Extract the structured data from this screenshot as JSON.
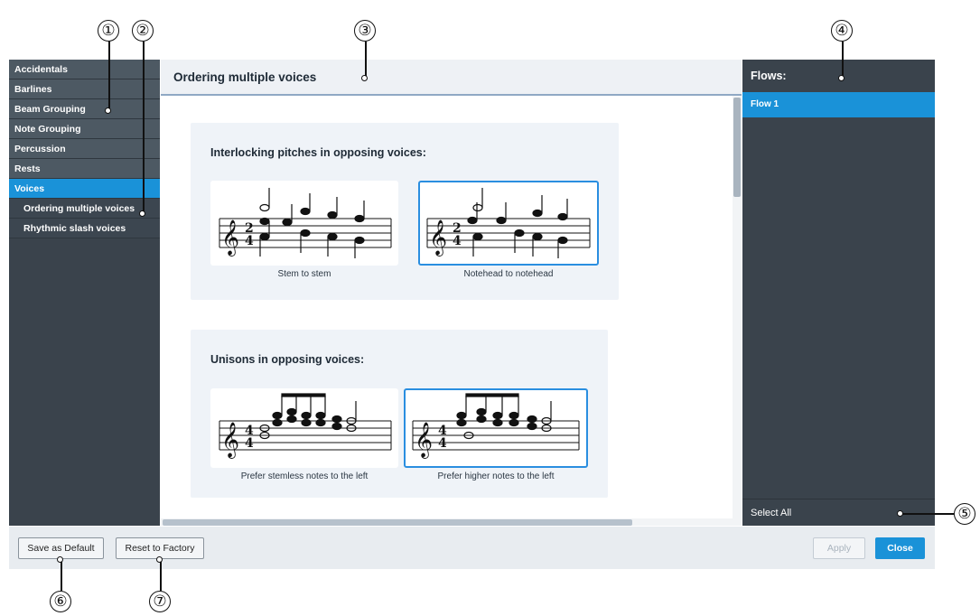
{
  "sidebar": {
    "items": [
      {
        "label": "Accidentals",
        "type": "category"
      },
      {
        "label": "Barlines",
        "type": "category"
      },
      {
        "label": "Beam Grouping",
        "type": "category"
      },
      {
        "label": "Note Grouping",
        "type": "category"
      },
      {
        "label": "Percussion",
        "type": "category"
      },
      {
        "label": "Rests",
        "type": "category"
      },
      {
        "label": "Voices",
        "type": "category",
        "active": true
      },
      {
        "label": "Ordering multiple voices",
        "type": "subcategory"
      },
      {
        "label": "Rhythmic slash voices",
        "type": "subcategory"
      }
    ]
  },
  "main": {
    "title": "Ordering multiple voices",
    "sections": [
      {
        "heading": "Interlocking pitches in opposing voices:",
        "options": [
          {
            "label": "Stem to stem",
            "selected": false
          },
          {
            "label": "Notehead to notehead",
            "selected": true
          }
        ]
      },
      {
        "heading": "Unisons in opposing voices:",
        "options": [
          {
            "label": "Prefer stemless notes to the left",
            "selected": false
          },
          {
            "label": "Prefer higher notes to the left",
            "selected": true
          }
        ]
      }
    ]
  },
  "right_panel": {
    "title": "Flows:",
    "flows": [
      {
        "label": "Flow 1",
        "selected": true
      }
    ],
    "select_all_label": "Select All"
  },
  "footer": {
    "save_default_label": "Save as Default",
    "reset_factory_label": "Reset to Factory",
    "apply_label": "Apply",
    "close_label": "Close"
  },
  "callouts": [
    "①",
    "②",
    "③",
    "④",
    "⑤",
    "⑥",
    "⑦"
  ],
  "colors": {
    "accent": "#1a92d8",
    "sidebar_bg": "#3a434c",
    "sidebar_item_bg": "#4d5963",
    "card_bg": "#eff3f8",
    "selected_border": "#2a8ee0"
  }
}
